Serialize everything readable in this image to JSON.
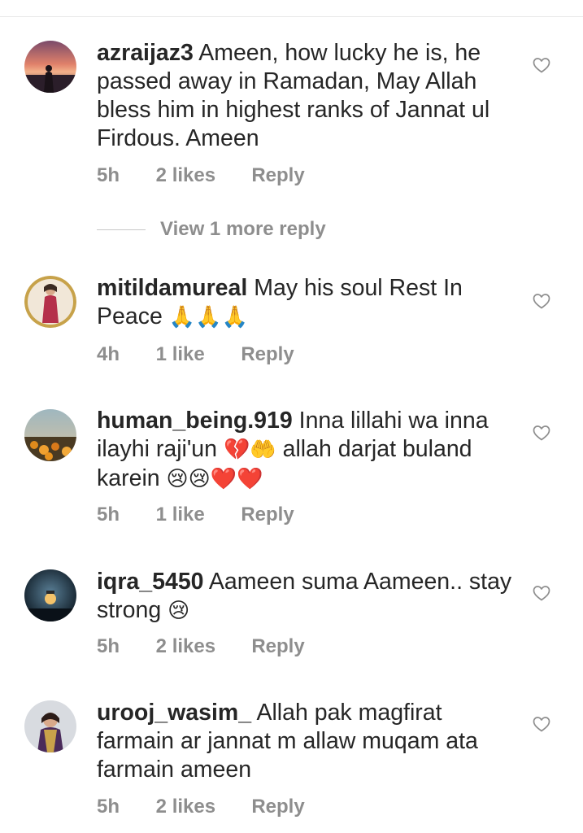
{
  "comments": [
    {
      "username": "azraijaz3",
      "text": "Ameen, how lucky he is, he passed away in Ramadan, May Allah bless him in highest ranks of Jannat ul Firdous. Ameen",
      "time": "5h",
      "likes": "2 likes",
      "reply": "Reply",
      "avatar": "sunset-silhouette"
    },
    {
      "username": "mitildamureal",
      "text": "May his soul Rest In Peace",
      "emoji": "🙏🙏🙏",
      "time": "4h",
      "likes": "1 like",
      "reply": "Reply",
      "avatar": "woman-red-dress"
    },
    {
      "username": "human_being.919",
      "text": "Inna lillahi wa inna ilayhi raji'un",
      "emoji_a": "💔🤲",
      "text_b": "allah darjat buland karein",
      "emoji_b": "😢😢❤️❤️",
      "time": "5h",
      "likes": "1 like",
      "reply": "Reply",
      "avatar": "orange-flowers"
    },
    {
      "username": "iqra_5450",
      "text": "Aameen suma Aameen.. stay strong",
      "emoji": "😢",
      "time": "5h",
      "likes": "2 likes",
      "reply": "Reply",
      "avatar": "night-lantern"
    },
    {
      "username": "urooj_wasim_",
      "text": "Allah pak magfirat farmain ar jannat m allaw muqam ata farmain ameen",
      "time": "5h",
      "likes": "2 likes",
      "reply": "Reply",
      "avatar": "girl-portrait"
    }
  ],
  "view_more_replies": "View 1 more reply",
  "icons": {
    "like": "heart-outline-icon"
  },
  "colors": {
    "text": "#262626",
    "meta": "#8e8e8e"
  }
}
